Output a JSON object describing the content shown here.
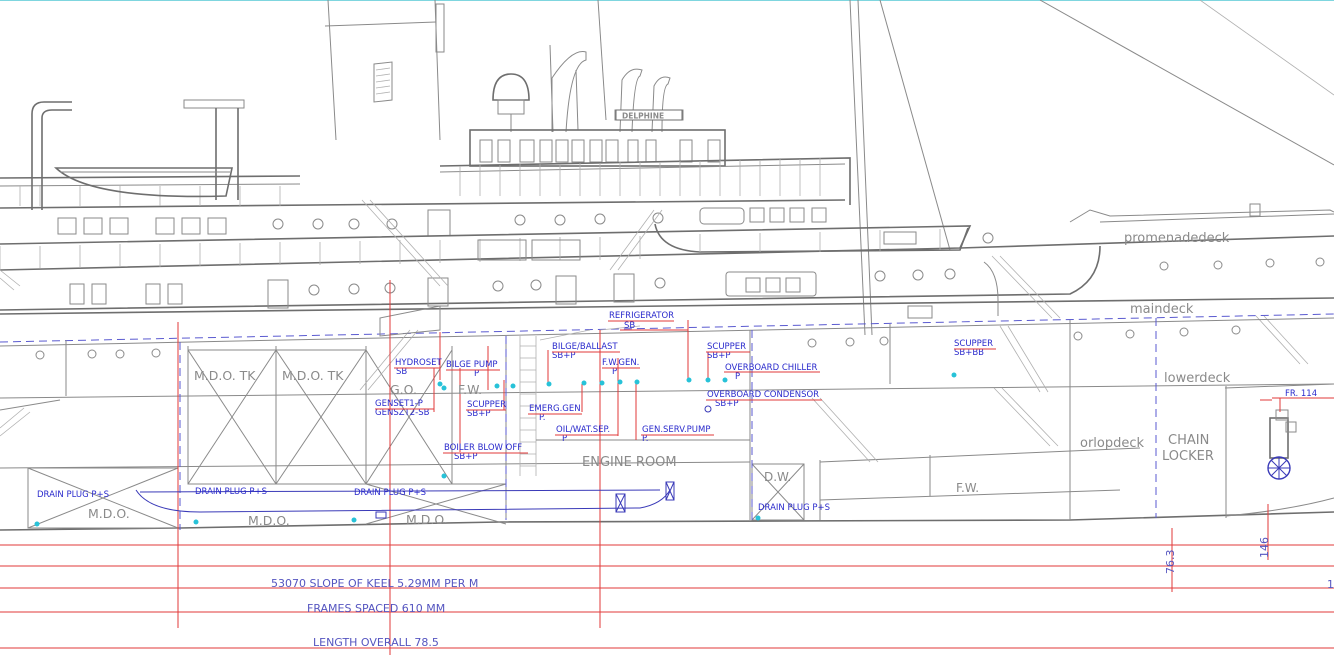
{
  "ship_name": "DELPHINE",
  "decks": [
    "promenadedeck",
    "maindeck",
    "lowerdeck",
    "orlopdeck"
  ],
  "tanks": {
    "mdo_tk_1": "M.D.O. TK",
    "mdo_tk_2": "M.D.O. TK",
    "go": "G.O.",
    "fw": "F.W.",
    "engine_room": "ENGINE ROOM",
    "dw": "D.W.",
    "fw_aft": "F.W.",
    "chain_locker_1": "CHAIN",
    "chain_locker_2": "LOCKER",
    "mdo_1": "M.D.O.",
    "mdo_2": "M.D.O.",
    "mdo_3": "M.D.O."
  },
  "labels": {
    "refrigerator_1": "REFRIGERATOR",
    "refrigerator_2": "SB",
    "bilge_ballast_1": "BILGE/BALLAST",
    "bilge_ballast_2": "SB+P",
    "fw_gen_1": "F.W.GEN.",
    "fw_gen_2": "P",
    "scupper_a_1": "SCUPPER",
    "scupper_a_2": "SB+P",
    "overboard_chiller_1": "OVERBOARD CHILLER",
    "overboard_chiller_2": "P",
    "overboard_condensor_1": "OVERBOARD CONDENSOR",
    "overboard_condensor_2": "SB+P",
    "scupper_b_1": "SCUPPER",
    "scupper_b_2": "SB+BB",
    "hydroset_1": "HYDROSET",
    "hydroset_2": "SB",
    "bilge_pump_1": "BILGE PUMP",
    "bilge_pump_2": "P",
    "genset_1": "GENSET1-P",
    "genset_2": "GENSZT2-SB",
    "scupper_c_1": "SCUPPER",
    "scupper_c_2": "SB+P",
    "emerg_gen_1": "EMERG.GEN",
    "emerg_gen_2": "P.",
    "oil_wat_sep_1": "OIL/WAT.SEP.",
    "oil_wat_sep_2": "P",
    "gen_serv_pump_1": "GEN.SERV.PUMP",
    "gen_serv_pump_2": "P.",
    "boiler_blow_off_1": "BOILER BLOW OFF",
    "boiler_blow_off_2": "SB+P",
    "drain_plug_1": "DRAIN PLUG P+S",
    "drain_plug_2": "DRAIN PLUG P+S",
    "drain_plug_3": "DRAIN PLUG P+S",
    "drain_plug_4": "DRAIN PLUG P+S",
    "frame": "FR. 114"
  },
  "dimensions": {
    "keel_slope": "53070   SLOPE OF KEEL 5.29MM PER M",
    "frames_spaced": "FRAMES SPACED 610 MM",
    "length_overall": "LENGTH OVERALL 78.5",
    "dim_763": "76.3",
    "dim_146": "146",
    "edge_digit": "1"
  }
}
